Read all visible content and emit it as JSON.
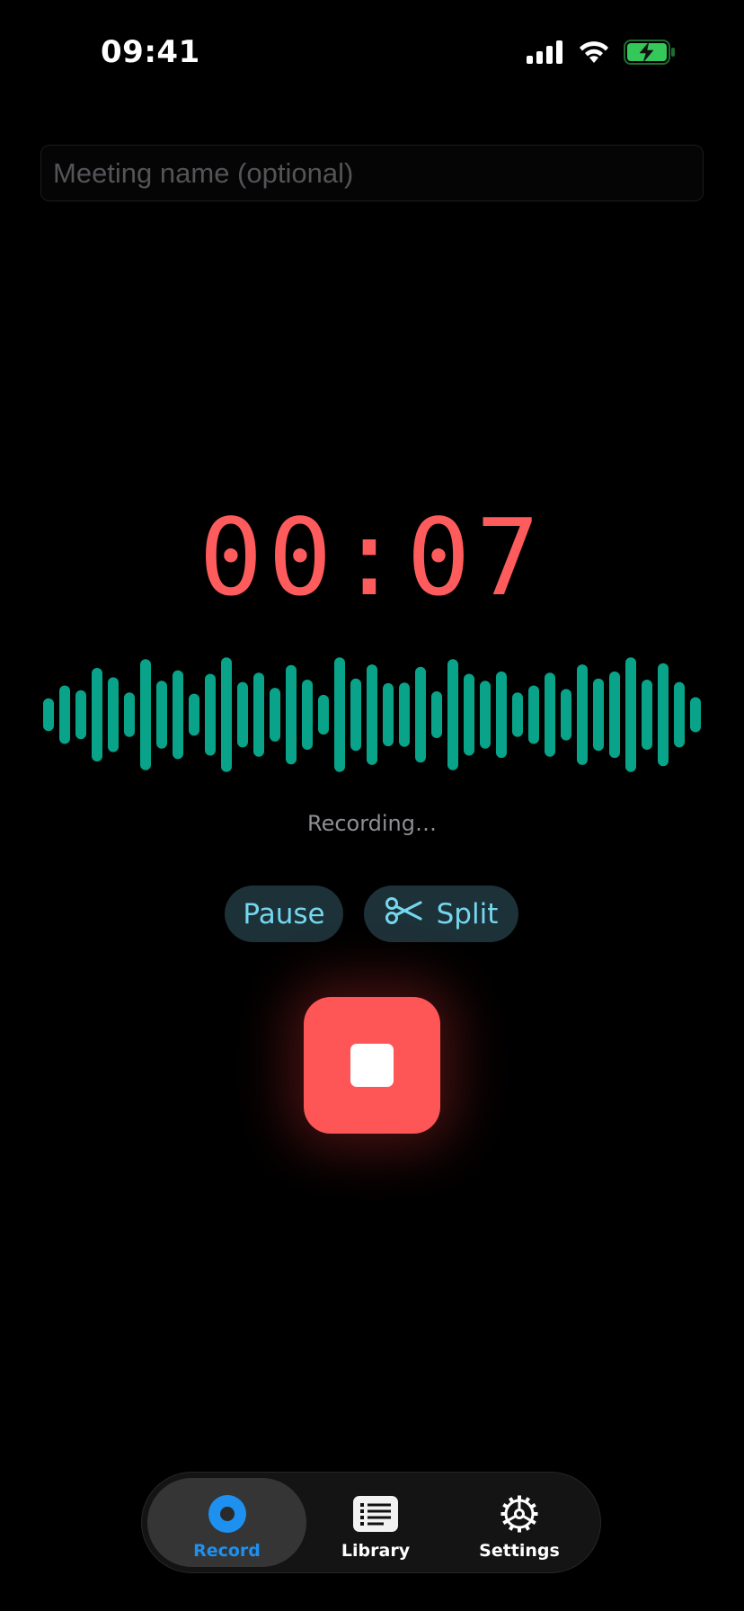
{
  "status_bar": {
    "time": "09:41",
    "icons": [
      "cellular-signal-icon",
      "wifi-icon",
      "battery-charging-icon"
    ],
    "battery_color": "#34c759"
  },
  "meeting": {
    "placeholder": "Meeting name (optional)",
    "value": ""
  },
  "timer": {
    "elapsed": "00:07",
    "color": "#fe5c5c"
  },
  "waveform": {
    "color": "#08a389",
    "levels": [
      0.28,
      0.5,
      0.42,
      0.8,
      0.64,
      0.38,
      0.95,
      0.58,
      0.76,
      0.36,
      0.7,
      0.98,
      0.56,
      0.72,
      0.46,
      0.85,
      0.6,
      0.34,
      0.98,
      0.62,
      0.86,
      0.54,
      0.55,
      0.82,
      0.4,
      0.95,
      0.7,
      0.58,
      0.74,
      0.38,
      0.5,
      0.72,
      0.44,
      0.86,
      0.62,
      0.74,
      0.98,
      0.6,
      0.88,
      0.56,
      0.3
    ]
  },
  "status_text": "Recording…",
  "controls": {
    "pause_label": "Pause",
    "split_label": "Split",
    "stop_color": "#fe5656"
  },
  "tabbar": {
    "accent": "#1e90f0",
    "tabs": [
      {
        "label": "Record",
        "icon": "record-icon",
        "selected": true
      },
      {
        "label": "Library",
        "icon": "list-icon",
        "selected": false
      },
      {
        "label": "Settings",
        "icon": "gear-icon",
        "selected": false
      }
    ]
  }
}
